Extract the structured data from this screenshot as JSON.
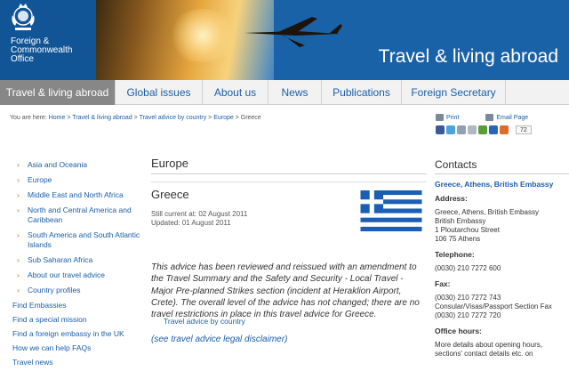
{
  "header": {
    "logo_lines": [
      "Foreign &",
      "Commonwealth",
      "Office"
    ],
    "title": "Travel & living abroad"
  },
  "nav": {
    "items": [
      {
        "label": "Travel & living abroad",
        "active": true
      },
      {
        "label": "Global issues"
      },
      {
        "label": "About us"
      },
      {
        "label": "News"
      },
      {
        "label": "Publications"
      },
      {
        "label": "Foreign Secretary"
      }
    ]
  },
  "breadcrumb": {
    "prefix": "You are here:",
    "items": [
      "Home",
      "Travel & living abroad",
      "Travel advice by country",
      "Europe"
    ],
    "current": "Greece"
  },
  "utils": {
    "print": "Print",
    "email": "Email Page",
    "share_count": "72"
  },
  "sidebar": {
    "heading": "Travel advice by country",
    "sub_items": [
      "Asia and Oceania",
      "Europe",
      "Middle East and North Africa",
      "North and Central America and Caribbean",
      "South America and South Atlantic Islands",
      "Sub Saharan Africa",
      "About our travel advice",
      "Country profiles"
    ],
    "links": [
      "Find Embassies",
      "Find a special mission",
      "Find a foreign embassy in the UK",
      "How we can help FAQs",
      "Travel news"
    ]
  },
  "main": {
    "section_title": "Europe",
    "country": "Greece",
    "still_current": "Still current at: 02 August 2011",
    "updated": "Updated: 01 August 2011",
    "advice": "This advice has been reviewed and reissued with an amendment to the Travel Summary and the Safety and Security - Local Travel - Major Pre-planned Strikes section (incident at Heraklion Airport, Crete). The overall level of the advice has not changed; there are no travel restrictions in place in this travel advice for Greece.",
    "disclaimer": "(see travel advice legal disclaimer)"
  },
  "contacts": {
    "title": "Contacts",
    "embassy": "Greece, Athens, British Embassy",
    "address_label": "Address:",
    "address_lines": [
      "Greece, Athens, British Embassy",
      "British Embassy",
      "1 Ploutarchou Street",
      "106 75 Athens"
    ],
    "telephone_label": "Telephone:",
    "telephone": "(0030) 210 7272 600",
    "fax_label": "Fax:",
    "fax_lines": [
      "(0030) 210 7272 743",
      "Consular/Visas/Passport Section Fax",
      "(0030) 210 7272 720"
    ],
    "office_hours_label": "Office hours:",
    "office_hours_text": "More details about opening hours, sections' contact details etc. on"
  },
  "colors": {
    "header_blue": "#1a62a8",
    "link_blue": "#1a5ea8",
    "nav_active": "#878787",
    "flag_blue": "#1a5fb4"
  }
}
